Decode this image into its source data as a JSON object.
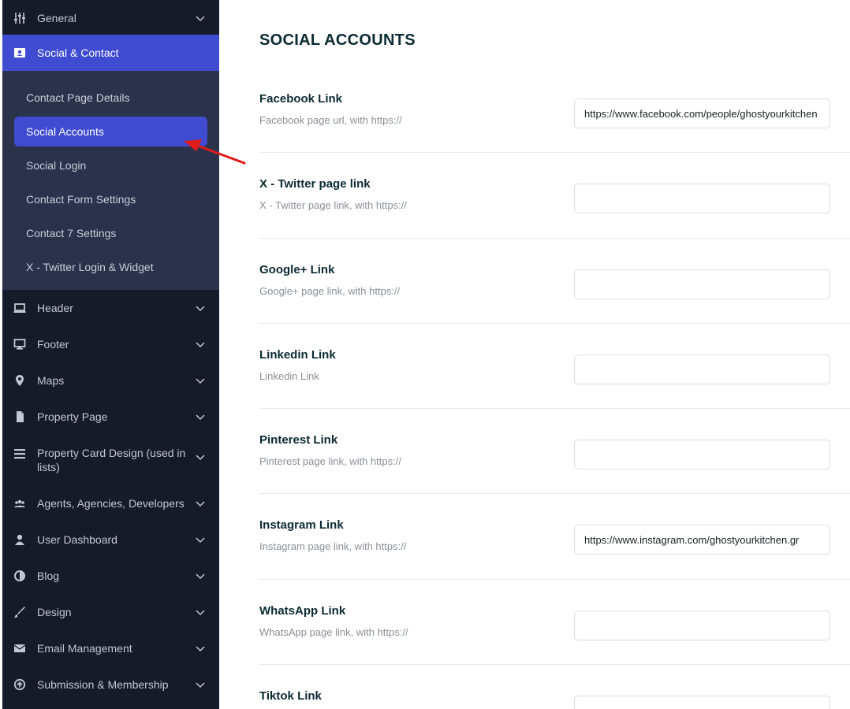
{
  "sidebar": {
    "general": "General",
    "social_contact": "Social & Contact",
    "submenu": [
      "Contact Page Details",
      "Social Accounts",
      "Social Login",
      "Contact Form Settings",
      "Contact 7 Settings",
      "X - Twitter Login & Widget"
    ],
    "items": [
      "Header",
      "Footer",
      "Maps",
      "Property Page",
      "Property Card Design (used in lists)",
      "Agents, Agencies, Developers",
      "User Dashboard",
      "Blog",
      "Design",
      "Email Management",
      "Submission & Membership"
    ]
  },
  "main": {
    "title": "SOCIAL ACCOUNTS",
    "fields": [
      {
        "label": "Facebook Link",
        "desc": "Facebook page url, with https://",
        "value": "https://www.facebook.com/people/ghostyourkitchen"
      },
      {
        "label": "X - Twitter page link",
        "desc": "X - Twitter page link, with https://",
        "value": ""
      },
      {
        "label": "Google+ Link",
        "desc": "Google+ page link, with https://",
        "value": ""
      },
      {
        "label": "Linkedin Link",
        "desc": "Linkedin Link",
        "value": ""
      },
      {
        "label": "Pinterest Link",
        "desc": "Pinterest page link, with https://",
        "value": ""
      },
      {
        "label": "Instagram Link",
        "desc": "Instagram page link, with https://",
        "value": "https://www.instagram.com/ghostyourkitchen.gr"
      },
      {
        "label": "WhatsApp Link",
        "desc": "WhatsApp page link, with https://",
        "value": ""
      },
      {
        "label": "Tiktok Link",
        "desc": "",
        "value": ""
      }
    ]
  },
  "colors": {
    "sidebar_bg": "#161b29",
    "submenu_bg": "#2b334c",
    "accent": "#3f4bd0",
    "annotation_arrow": "#e01b1b"
  }
}
